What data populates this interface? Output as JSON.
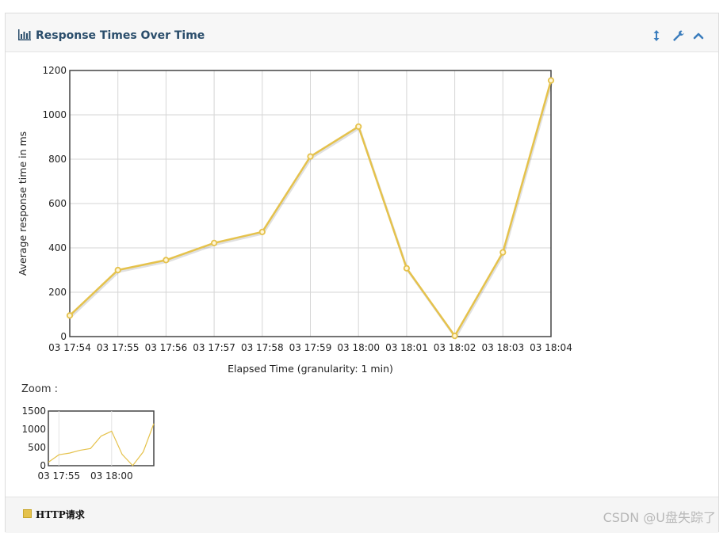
{
  "panel": {
    "title": "Response Times Over Time",
    "icons": [
      "bar-chart-icon",
      "resize-vertical-icon",
      "wrench-icon",
      "chevron-up-icon"
    ]
  },
  "zoom": {
    "label": "Zoom :"
  },
  "legend": {
    "label": "HTTP请求",
    "color": "#e5c24c"
  },
  "watermark": "CSDN @U盘失踪了",
  "chart_data": [
    {
      "type": "line",
      "title": "",
      "xlabel": "Elapsed Time (granularity: 1 min)",
      "ylabel": "Average response time in ms",
      "ylim": [
        0,
        1200
      ],
      "yticks": [
        0,
        200,
        400,
        600,
        800,
        1000,
        1200
      ],
      "categories": [
        "03 17:54",
        "03 17:55",
        "03 17:56",
        "03 17:57",
        "03 17:58",
        "03 17:59",
        "03 18:00",
        "03 18:01",
        "03 18:02",
        "03 18:03",
        "03 18:04"
      ],
      "series": [
        {
          "name": "HTTP请求",
          "color": "#e5c24c",
          "values": [
            95,
            300,
            345,
            422,
            472,
            812,
            947,
            308,
            3,
            380,
            1155
          ]
        }
      ],
      "grid": true,
      "markers": true
    },
    {
      "type": "line",
      "title": "",
      "xlabel": "",
      "ylabel": "",
      "ylim": [
        0,
        1500
      ],
      "yticks": [
        0,
        500,
        1000,
        1500
      ],
      "xticks": [
        "03 17:55",
        "03 18:00"
      ],
      "categories": [
        "03 17:54",
        "03 17:55",
        "03 17:56",
        "03 17:57",
        "03 17:58",
        "03 17:59",
        "03 18:00",
        "03 18:01",
        "03 18:02",
        "03 18:03",
        "03 18:04"
      ],
      "series": [
        {
          "name": "HTTP请求",
          "color": "#e5c24c",
          "values": [
            95,
            300,
            345,
            422,
            472,
            812,
            947,
            308,
            3,
            380,
            1155
          ]
        }
      ],
      "grid": false
    }
  ]
}
